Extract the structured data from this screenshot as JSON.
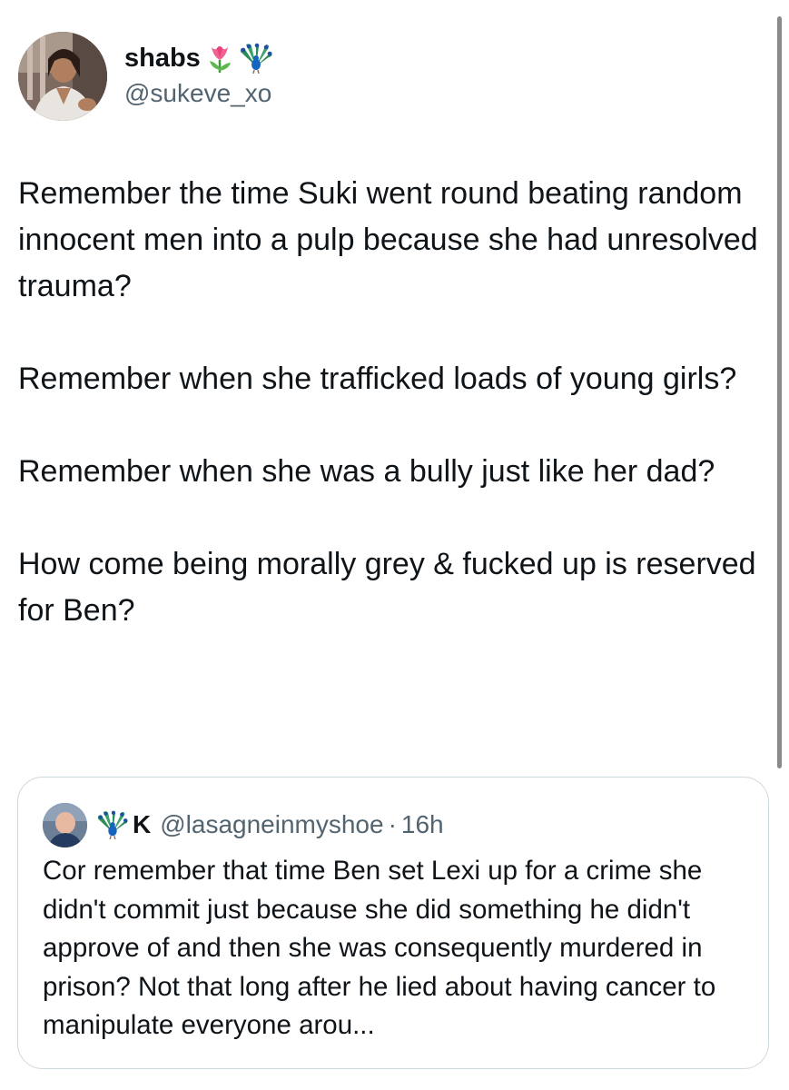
{
  "author": {
    "name": "shabs",
    "handle": "@sukeve_xo",
    "name_icons": [
      "tulip-icon",
      "peacock-icon"
    ]
  },
  "tweet": {
    "paragraphs": [
      "Remember the time Suki went round beating random innocent men into a pulp because she had unresolved trauma?",
      "Remember when she trafficked loads of young girls?",
      "Remember when she was a bully just like her dad?",
      "How come being morally grey & fucked up is reserved for Ben?"
    ]
  },
  "quote": {
    "name_icon": "peacock-icon",
    "name": "K",
    "handle": "@lasagneinmyshoe",
    "separator": "·",
    "time": "16h",
    "text": "Cor remember that time Ben set Lexi up for a crime she didn't commit just because she did something he didn't approve of and then she was consequently murdered in prison? Not that long after he lied about having cancer to manipulate everyone arou..."
  },
  "colors": {
    "text_primary": "#0f1419",
    "text_secondary": "#536471",
    "border": "#cfd9de",
    "scrollbar": "#8a8a8a"
  }
}
